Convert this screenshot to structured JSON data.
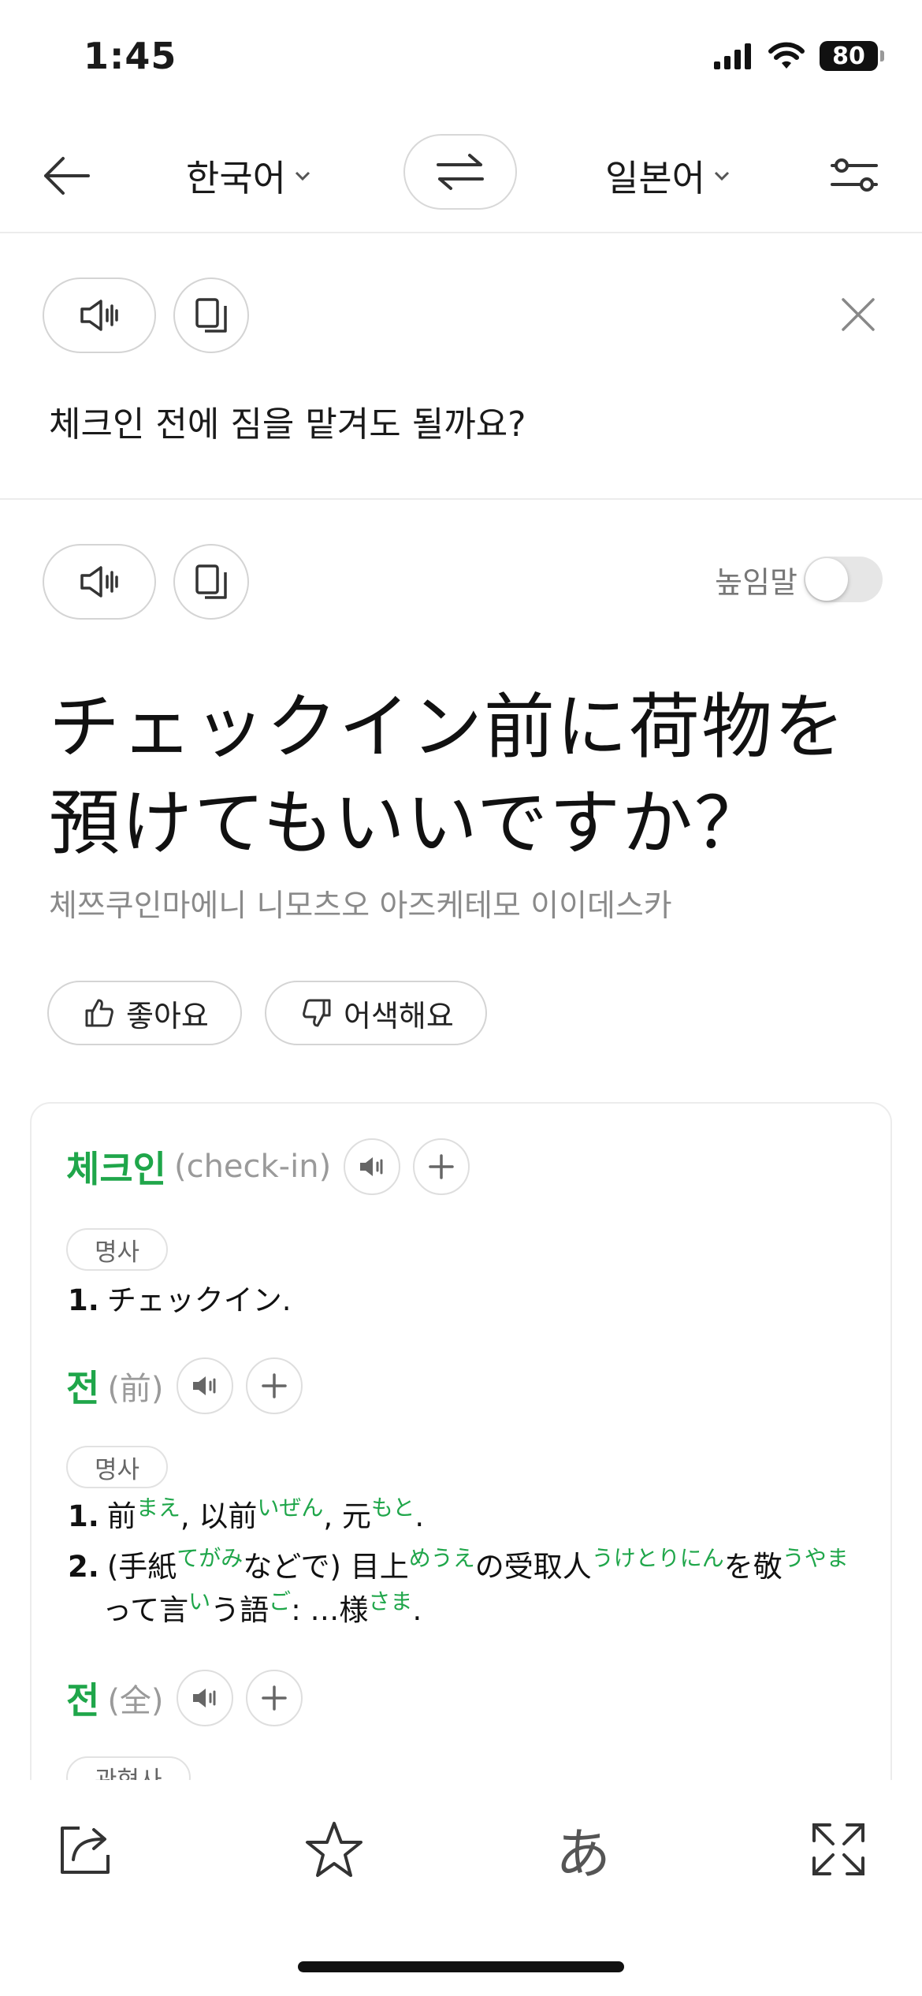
{
  "status": {
    "time": "1:45",
    "battery": "80"
  },
  "header": {
    "source_lang": "한국어",
    "target_lang": "일본어"
  },
  "source": {
    "text": "체크인 전에 짐을 맡겨도 될까요?"
  },
  "result": {
    "honorific_label": "높임말",
    "honorific_on": false,
    "translation_line1": "チェックイン前に荷物を",
    "translation_line2": "預けてもいいですか？",
    "pronunciation": "체쯔쿠인마에니 니모츠오 아즈케테모 이이데스카",
    "like_label": "좋아요",
    "dislike_label": "어색해요"
  },
  "dictionary": {
    "entry1": {
      "word": "체크인",
      "orig": "(check-in)",
      "pos": "명사",
      "sense1_num": "1.",
      "sense1_text": "チェックイン."
    },
    "entry2": {
      "word": "전",
      "orig": "(前)",
      "pos": "명사",
      "sense1": {
        "num": "1.",
        "a": "前",
        "a_ruby": "まえ",
        "b": ", 以前",
        "b_ruby": "いぜん",
        "c": ", 元",
        "c_ruby": "もと",
        "end": "."
      },
      "sense2": {
        "num": "2.",
        "a": "(手紙",
        "a_ruby": "てがみ",
        "b": "などで) 目上",
        "b_ruby": "めうえ",
        "c": "の受取人",
        "c_ruby": "うけとりにん",
        "d": "を敬",
        "d_ruby": "うやま",
        "e": "って言",
        "e_ruby": "い",
        "f": "う語",
        "f_ruby": "ご",
        "g": ": …様",
        "g_ruby": "さま",
        "end": "."
      }
    },
    "entry3": {
      "word": "전",
      "orig": "(全)",
      "pos": "관형사"
    }
  },
  "bottom": {
    "kana": "あ"
  },
  "colors": {
    "accent_green": "#1fa64a",
    "border": "#d4d4d4"
  }
}
